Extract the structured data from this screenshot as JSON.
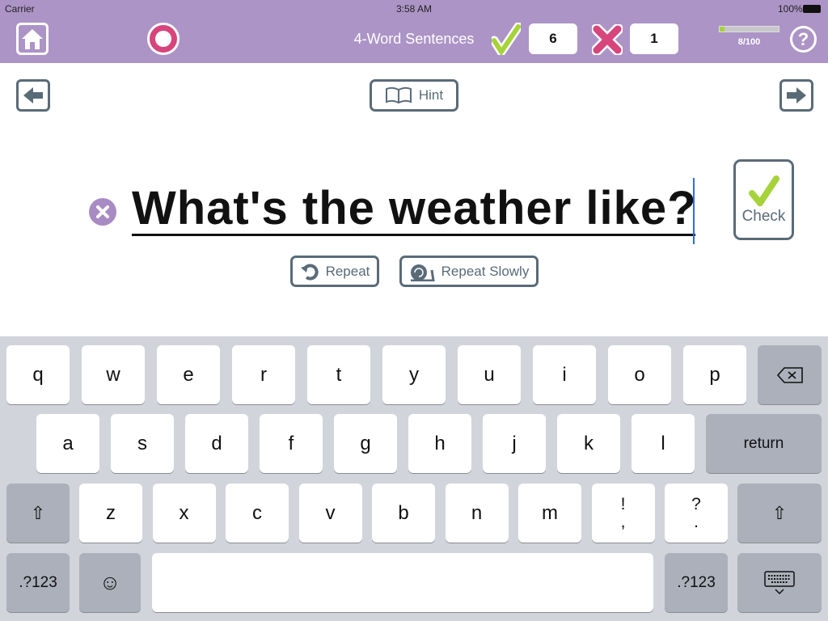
{
  "status": {
    "carrier": "Carrier",
    "time": "3:58 AM",
    "battery": "100%"
  },
  "header": {
    "title": "4-Word Sentences",
    "correct_count": "6",
    "wrong_count": "1",
    "progress_text": "8/100",
    "progress_fraction": 0.08,
    "colors": {
      "bar": "#ac94c6",
      "check": "#a6d33a",
      "cross": "#d6457c"
    }
  },
  "toolbar": {
    "hint_label": "Hint"
  },
  "exercise": {
    "sentence": "What's the weather like?",
    "check_label": "Check",
    "repeat_label": "Repeat",
    "repeat_slowly_label": "Repeat Slowly"
  },
  "keyboard": {
    "row1": [
      "q",
      "w",
      "e",
      "r",
      "t",
      "y",
      "u",
      "i",
      "o",
      "p"
    ],
    "row2": [
      "a",
      "s",
      "d",
      "f",
      "g",
      "h",
      "j",
      "k",
      "l"
    ],
    "row3": [
      "z",
      "x",
      "c",
      "v",
      "b",
      "n",
      "m",
      "!\n,",
      "?\n."
    ],
    "return_label": "return",
    "numbers_label": ".?123"
  }
}
